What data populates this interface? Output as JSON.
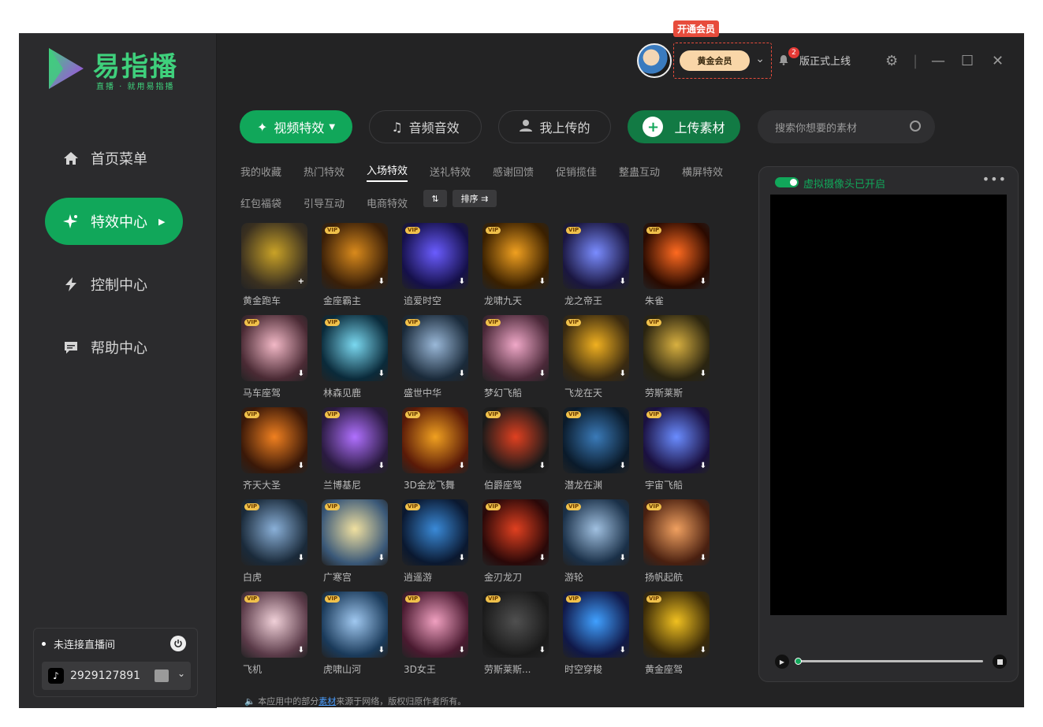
{
  "brand": {
    "title": "易指播",
    "subtitle": "直播 · 就用易指播"
  },
  "nav": [
    {
      "label": "首页菜单",
      "icon": "home-icon"
    },
    {
      "label": "特效中心",
      "icon": "sparkle-icon"
    },
    {
      "label": "控制中心",
      "icon": "lightning-icon"
    },
    {
      "label": "帮助中心",
      "icon": "chat-icon"
    }
  ],
  "live": {
    "status": "未连接直播间",
    "account_id": "2929127891"
  },
  "top": {
    "vip_tag": "开通会员",
    "membership": "黄金会员",
    "notice_count": "2",
    "version_text": "版正式上线"
  },
  "tabs": [
    {
      "label": "视频特效",
      "icon": "sparkle-icon"
    },
    {
      "label": "音频音效",
      "icon": "music-icon"
    },
    {
      "label": "我上传的",
      "icon": "user-icon"
    },
    {
      "label": "上传素材",
      "icon": "plus-icon"
    }
  ],
  "search_placeholder": "搜索你想要的素材",
  "categories": [
    "我的收藏",
    "热门特效",
    "入场特效",
    "送礼特效",
    "感谢回馈",
    "促销揽佳",
    "整蛊互动",
    "横屏特效",
    "红包福袋",
    "引导互动",
    "电商特效"
  ],
  "active_category": "入场特效",
  "sort": {
    "order_icon": "⇅",
    "label": "排序 ⇉"
  },
  "vip_label": "VIP",
  "effects": [
    {
      "name": "黄金跑车",
      "vip": false,
      "action": "+",
      "c1": "#c9a227",
      "c2": "#3a3020"
    },
    {
      "name": "金座霸主",
      "vip": true,
      "action": "⬇",
      "c1": "#d98a1c",
      "c2": "#3a1f08"
    },
    {
      "name": "追爱时空",
      "vip": true,
      "action": "⬇",
      "c1": "#6a5cff",
      "c2": "#15104a"
    },
    {
      "name": "龙啸九天",
      "vip": true,
      "action": "⬇",
      "c1": "#f0a020",
      "c2": "#3a2000"
    },
    {
      "name": "龙之帝王",
      "vip": true,
      "action": "⬇",
      "c1": "#7a8cff",
      "c2": "#1a1640"
    },
    {
      "name": "朱雀",
      "vip": true,
      "action": "⬇",
      "c1": "#ff6a20",
      "c2": "#2a0a00"
    },
    {
      "name": "马车座驾",
      "vip": true,
      "action": "⬇",
      "c1": "#f2b8c6",
      "c2": "#4a2a34"
    },
    {
      "name": "林森见鹿",
      "vip": true,
      "action": "⬇",
      "c1": "#7ad8f0",
      "c2": "#0a2a3a"
    },
    {
      "name": "盛世中华",
      "vip": true,
      "action": "⬇",
      "c1": "#9ab8d8",
      "c2": "#1a2a3a"
    },
    {
      "name": "梦幻飞船",
      "vip": true,
      "action": "⬇",
      "c1": "#f0a8c8",
      "c2": "#4a2838"
    },
    {
      "name": "飞龙在天",
      "vip": true,
      "action": "⬇",
      "c1": "#f0b020",
      "c2": "#3a2a10"
    },
    {
      "name": "劳斯莱斯",
      "vip": true,
      "action": "⬇",
      "c1": "#d8b040",
      "c2": "#2a2410"
    },
    {
      "name": "齐天大圣",
      "vip": true,
      "action": "⬇",
      "c1": "#f08020",
      "c2": "#3a1808"
    },
    {
      "name": "兰博基尼",
      "vip": true,
      "action": "⬇",
      "c1": "#b070ff",
      "c2": "#2a1a40"
    },
    {
      "name": "3D金龙飞舞",
      "vip": true,
      "action": "⬇",
      "c1": "#f0a020",
      "c2": "#5a1a08"
    },
    {
      "name": "伯爵座驾",
      "vip": true,
      "action": "⬇",
      "c1": "#e04020",
      "c2": "#1a1a1a"
    },
    {
      "name": "潜龙在渊",
      "vip": true,
      "action": "⬇",
      "c1": "#3a7ab8",
      "c2": "#0a1a2a"
    },
    {
      "name": "宇宙飞船",
      "vip": true,
      "action": "⬇",
      "c1": "#6a8cff",
      "c2": "#1a1040"
    },
    {
      "name": "白虎",
      "vip": true,
      "action": "⬇",
      "c1": "#8ab0d8",
      "c2": "#1a2a3a"
    },
    {
      "name": "广寒宫",
      "vip": true,
      "action": "⬇",
      "c1": "#f0e0a0",
      "c2": "#3a5878"
    },
    {
      "name": "逍遥游",
      "vip": true,
      "action": "⬇",
      "c1": "#3a8ad8",
      "c2": "#0a1830"
    },
    {
      "name": "金刃龙刀",
      "vip": true,
      "action": "⬇",
      "c1": "#e04020",
      "c2": "#2a0808"
    },
    {
      "name": "游轮",
      "vip": true,
      "action": "⬇",
      "c1": "#a0c0e0",
      "c2": "#1a3048"
    },
    {
      "name": "扬帆起航",
      "vip": true,
      "action": "⬇",
      "c1": "#f0a060",
      "c2": "#4a2010"
    },
    {
      "name": "飞机",
      "vip": true,
      "action": "⬇",
      "c1": "#f0d0d8",
      "c2": "#5a3a48"
    },
    {
      "name": "虎啸山河",
      "vip": true,
      "action": "⬇",
      "c1": "#a0c8f0",
      "c2": "#1a3a5a"
    },
    {
      "name": "3D女王",
      "vip": true,
      "action": "⬇",
      "c1": "#f0a0c0",
      "c2": "#4a1a30"
    },
    {
      "name": "劳斯莱斯...",
      "vip": true,
      "action": "⬇",
      "c1": "#505050",
      "c2": "#1a1a1a"
    },
    {
      "name": "时空穿梭",
      "vip": true,
      "action": "⬇",
      "c1": "#40a0ff",
      "c2": "#101848"
    },
    {
      "name": "黄金座驾",
      "vip": true,
      "action": "⬇",
      "c1": "#f0c020",
      "c2": "#3a2a08"
    }
  ],
  "preview": {
    "camera_label": "虚拟摄像头已开启",
    "more": "•••"
  },
  "footer": {
    "prefix": "本应用中的部分",
    "link": "素材",
    "suffix": "来源于网络，版权归原作者所有。"
  },
  "colors": {
    "accent": "#11a75a",
    "alert": "#e74c3c",
    "bg": "#232324"
  }
}
